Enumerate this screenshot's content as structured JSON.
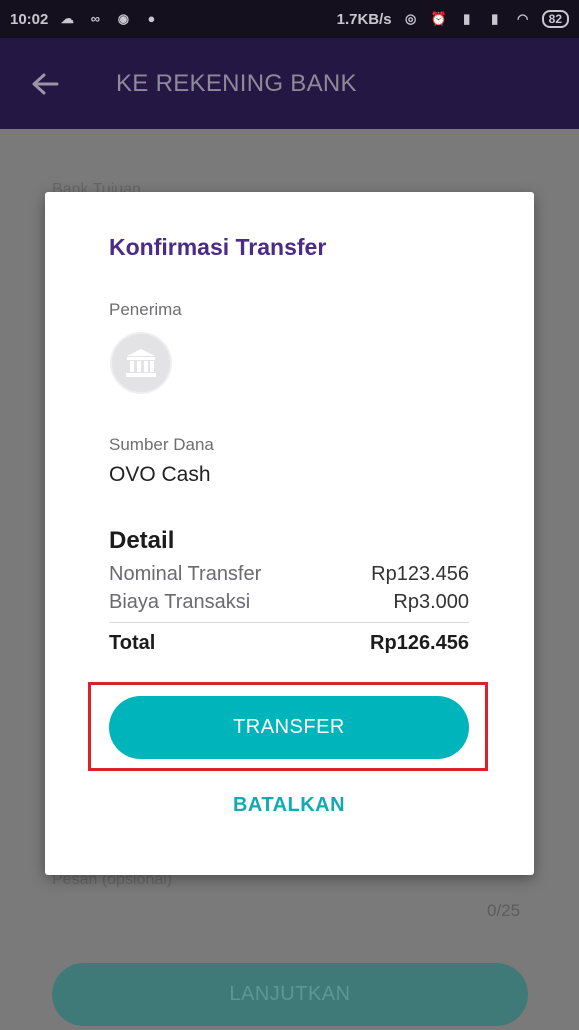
{
  "status_bar": {
    "time": "10:02",
    "network_speed": "1.7KB/s",
    "battery": "82"
  },
  "app_bar": {
    "title": "KE REKENING BANK"
  },
  "background": {
    "bank_label": "Bank Tujuan",
    "message_label": "Pesan (opsional)",
    "char_counter": "0/25",
    "continue_button": "LANJUTKAN"
  },
  "dialog": {
    "title": "Konfirmasi Transfer",
    "recipient_label": "Penerima",
    "source_label": "Sumber Dana",
    "source_value": "OVO Cash",
    "detail_title": "Detail",
    "rows": [
      {
        "label": "Nominal Transfer",
        "value": "Rp123.456"
      },
      {
        "label": "Biaya Transaksi",
        "value": "Rp3.000"
      }
    ],
    "total": {
      "label": "Total",
      "value": "Rp126.456"
    },
    "transfer_button": "TRANSFER",
    "cancel_button": "BATALKAN"
  },
  "colors": {
    "app_bar": "#251743",
    "title_purple": "#4a2b8a",
    "accent_teal": "#00b4bc",
    "highlight_red": "#d8232a"
  }
}
